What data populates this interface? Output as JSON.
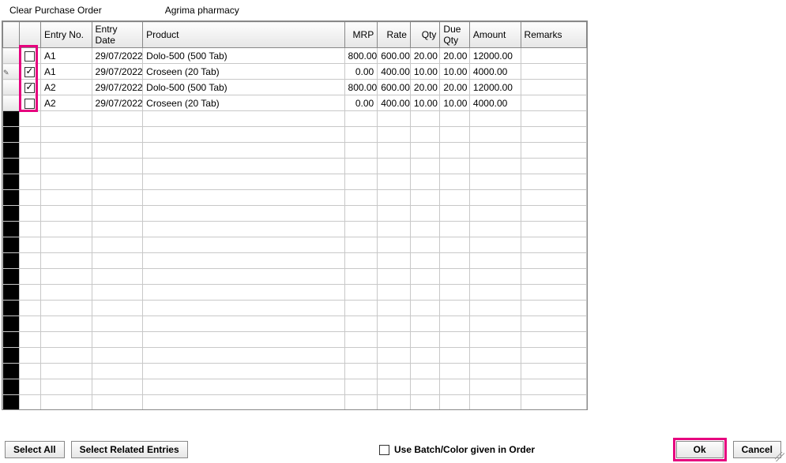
{
  "header": {
    "title": "Clear Purchase Order",
    "vendor": "Agrima pharmacy"
  },
  "columns": {
    "entry_no": "Entry No.",
    "entry_date": "Entry Date",
    "product": "Product",
    "mrp": "MRP",
    "rate": "Rate",
    "qty": "Qty",
    "due_qty": "Due Qty",
    "amount": "Amount",
    "remarks": "Remarks"
  },
  "rows": [
    {
      "checked": false,
      "editing": false,
      "entry_no": "A1",
      "entry_date": "29/07/2022",
      "product": "Dolo-500 (500 Tab)",
      "mrp": "800.00",
      "rate": "600.00",
      "qty": "20.00",
      "due_qty": "20.00",
      "amount": "12000.00",
      "remarks": ""
    },
    {
      "checked": true,
      "editing": true,
      "entry_no": "A1",
      "entry_date": "29/07/2022",
      "product": "Croseen (20 Tab)",
      "mrp": "0.00",
      "rate": "400.00",
      "qty": "10.00",
      "due_qty": "10.00",
      "amount": "4000.00",
      "remarks": ""
    },
    {
      "checked": true,
      "editing": false,
      "entry_no": "A2",
      "entry_date": "29/07/2022",
      "product": "Dolo-500 (500 Tab)",
      "mrp": "800.00",
      "rate": "600.00",
      "qty": "20.00",
      "due_qty": "20.00",
      "amount": "12000.00",
      "remarks": ""
    },
    {
      "checked": false,
      "editing": false,
      "entry_no": "A2",
      "entry_date": "29/07/2022",
      "product": "Croseen (20 Tab)",
      "mrp": "0.00",
      "rate": "400.00",
      "qty": "10.00",
      "due_qty": "10.00",
      "amount": "4000.00",
      "remarks": ""
    }
  ],
  "empty_row_count": 19,
  "footer": {
    "select_all": "Select All",
    "select_related": "Select Related Entries",
    "use_batch_label": "Use Batch/Color given in Order",
    "use_batch_checked": false,
    "ok": "Ok",
    "cancel": "Cancel"
  }
}
